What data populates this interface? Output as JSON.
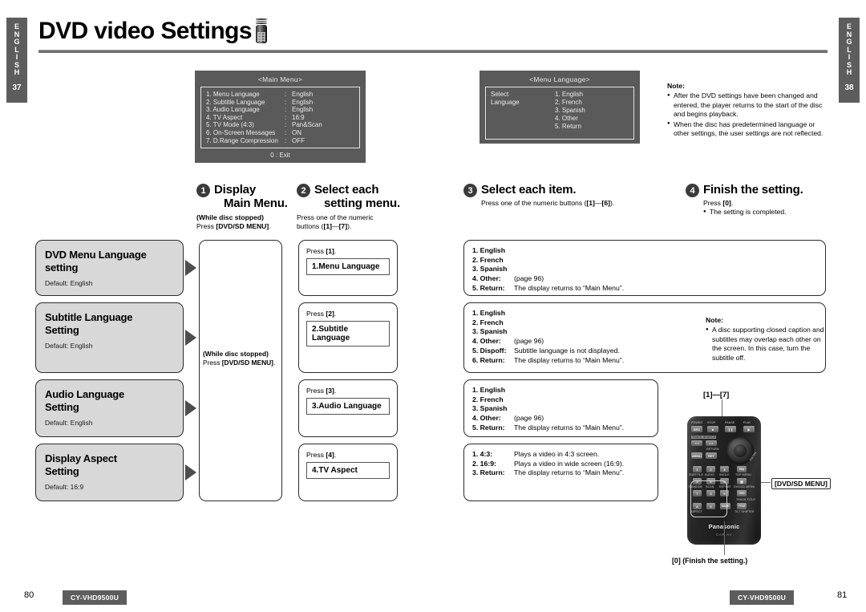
{
  "side_tabs": {
    "left": {
      "letters": [
        "E",
        "N",
        "G",
        "L",
        "I",
        "S",
        "H"
      ],
      "page": "37"
    },
    "right": {
      "letters": [
        "E",
        "N",
        "G",
        "L",
        "I",
        "S",
        "H"
      ],
      "page": "38"
    }
  },
  "header": {
    "title": "DVD video Settings",
    "icon": "remote-control-icon"
  },
  "tv_screens": [
    {
      "id": "main-menu",
      "title": "<Main Menu>",
      "rows": [
        {
          "label": "1. Menu  Language",
          "sep": ":",
          "value": "English"
        },
        {
          "label": "2. Subtitle  Language",
          "sep": ":",
          "value": "English"
        },
        {
          "label": "3. Audio  Language",
          "sep": ":",
          "value": "English"
        },
        {
          "label": "4. TV Aspect",
          "sep": ":",
          "value": "16:9"
        },
        {
          "label": "5. TV Mode (4:3)",
          "sep": ":",
          "value": "Pan&Scan"
        },
        {
          "label": "6. On-Screen Messages",
          "sep": ":",
          "value": "ON"
        },
        {
          "label": "7. D.Range Compression",
          "sep": ":",
          "value": "OFF"
        }
      ],
      "footer": "0  :  Exit"
    },
    {
      "id": "menu-language",
      "title": "<Menu  Language>",
      "left_lines": [
        "Select",
        "Language"
      ],
      "right_lines": [
        "1. English",
        "2. French",
        "3. Spanish",
        "4. Other",
        "5. Return"
      ]
    }
  ],
  "notes": {
    "top": {
      "heading": "Note:",
      "items": [
        "After the DVD settings have been changed and entered, the player returns to the start of the disc and begins playback.",
        "When the disc has predetermined language or other settings, the user settings are not reflected."
      ]
    },
    "subtitle": {
      "heading": "Note:",
      "items": [
        "A disc supporting closed caption and subtitles may overlap each other on the screen. In this case, turn the subtitle off."
      ]
    }
  },
  "steps": [
    {
      "num": "1",
      "title_line1": "Display",
      "title_line2": "Main Menu.",
      "sub_bold": "(While disc stopped)",
      "sub_text_pre": "Press ",
      "sub_text_bold": "[DVD/SD MENU]",
      "sub_text_post": "."
    },
    {
      "num": "2",
      "title_line1": "Select each",
      "title_line2": "setting menu.",
      "sub_line1": "Press  one of the numeric",
      "sub_line2_pre": "buttons (",
      "sub_line2_b1": "[1]",
      "sub_line2_mid": "—",
      "sub_line2_b2": "[7]",
      "sub_line2_post": ")."
    },
    {
      "num": "3",
      "title_line1": "Select each item.",
      "sub_pre": "Press  one of the numeric buttons (",
      "sub_b1": "[1]",
      "sub_mid": "—",
      "sub_b2": "[6]",
      "sub_post": ")."
    },
    {
      "num": "4",
      "title_line1": "Finish the setting.",
      "sub_pre": "Press ",
      "sub_b1": "[0]",
      "sub_post": ".",
      "sub_bullet": "The setting is completed."
    }
  ],
  "setting_cards": [
    {
      "title_line1": "DVD Menu Language",
      "title_line2": "setting",
      "default": "Default: English"
    },
    {
      "title_line1": "Subtitle Language",
      "title_line2": "Setting",
      "default": "Default: English"
    },
    {
      "title_line1": "Audio Language",
      "title_line2": "Setting",
      "default": "Default: English"
    },
    {
      "title_line1": "Display Aspect",
      "title_line2": "Setting",
      "default": "Default: 16:9"
    }
  ],
  "column1_note": {
    "bold": "(While disc stopped)",
    "pre": "Press ",
    "key": "[DVD/SD MENU]",
    "post": "."
  },
  "press_panels": [
    {
      "press_pre": "Press ",
      "press_key": "[1]",
      "press_post": ".",
      "box": "1.Menu Language"
    },
    {
      "press_pre": "Press ",
      "press_key": "[2]",
      "press_post": ".",
      "box": "2.Subtitle Language"
    },
    {
      "press_pre": "Press ",
      "press_key": "[3]",
      "press_post": ".",
      "box": "3.Audio Language"
    },
    {
      "press_pre": "Press ",
      "press_key": "[4]",
      "press_post": ".",
      "box": "4.TV Aspect"
    }
  ],
  "option_panels": [
    {
      "id": "menu-language-options",
      "rows": [
        {
          "key": "1. English",
          "value": ""
        },
        {
          "key": "2. French",
          "value": ""
        },
        {
          "key": "3. Spanish",
          "value": ""
        },
        {
          "key": "4. Other:",
          "value": "(page 96)"
        },
        {
          "key": "5. Return:",
          "value": "The display returns to “Main Menu”."
        }
      ]
    },
    {
      "id": "subtitle-language-options",
      "rows": [
        {
          "key": "1. English",
          "value": ""
        },
        {
          "key": "2. French",
          "value": ""
        },
        {
          "key": "3. Spanish",
          "value": ""
        },
        {
          "key": "4. Other:",
          "value": "(page 96)"
        },
        {
          "key": "5. Dispoff:",
          "value": "Subtitle language is not displayed."
        },
        {
          "key": "6. Return:",
          "value": "The display returns to “Main Menu”."
        }
      ]
    },
    {
      "id": "audio-language-options",
      "rows": [
        {
          "key": "1. English",
          "value": ""
        },
        {
          "key": "2. French",
          "value": ""
        },
        {
          "key": "3. Spanish",
          "value": ""
        },
        {
          "key": "4. Other:",
          "value": "(page 96)"
        },
        {
          "key": "5. Return:",
          "value": "The display returns to “Main Menu”."
        }
      ]
    },
    {
      "id": "tv-aspect-options",
      "rows": [
        {
          "key": "1. 4:3:",
          "value": "Plays a video in 4:3 screen."
        },
        {
          "key": "2. 16:9:",
          "value": "Plays a video in wide screen (16:9)."
        },
        {
          "key": "3. Return:",
          "value": "The display returns to “Main Menu”."
        }
      ]
    }
  ],
  "remote": {
    "callout_keys": "[1]—[7]",
    "callout_menu": "[DVD/SD MENU]",
    "callout_zero": "[0] (Finish the setting.)",
    "brand": "Panasonic",
    "brand_sub": "CAR AV",
    "row_labels_top": [
      "POWER",
      "STOP",
      "PAUSE",
      "PLAY"
    ],
    "keys_top": [
      "SRC",
      "■",
      "❙❙",
      "▶"
    ],
    "track_search": "TRACK SEARCH",
    "return_label": "RETURN",
    "menu_keys": [
      "MENU",
      "RET"
    ],
    "enter_label": "ENTER",
    "numeric": [
      "1",
      "2",
      "3",
      "4",
      "5",
      "6",
      "7",
      "8",
      "9",
      "A",
      "0",
      "SAVE"
    ],
    "numeric_sub": [
      "SUBTITLE",
      "AUDIO",
      "ANGLE",
      "RANDOM",
      "SCAN",
      "REPEAT",
      "ASPECT"
    ],
    "right_keys": [
      "Skip",
      "TOP MENU",
      "DVD/SD MENU",
      "OSD",
      "TRACK TITLE",
      "TILT SHIFTER"
    ]
  },
  "footer": {
    "page_left": "80",
    "page_right": "81",
    "model_left": "CY-VHD9500U",
    "model_right": "CY-VHD9500U"
  }
}
